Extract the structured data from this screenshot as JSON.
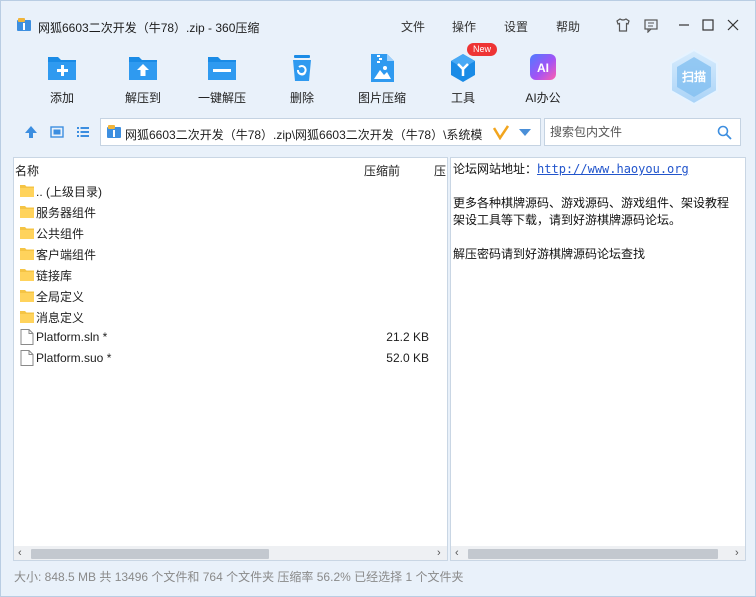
{
  "window": {
    "title": "网狐6603二次开发（牛78）.zip - 360压缩",
    "menu": [
      "文件",
      "操作",
      "设置",
      "帮助"
    ]
  },
  "toolbar": {
    "items": [
      {
        "label": "添加",
        "icon": "add-icon"
      },
      {
        "label": "解压到",
        "icon": "extract-to-icon"
      },
      {
        "label": "一键解压",
        "icon": "one-click-extract-icon"
      },
      {
        "label": "删除",
        "icon": "delete-icon"
      },
      {
        "label": "图片压缩",
        "icon": "image-compress-icon"
      },
      {
        "label": "工具",
        "icon": "tools-icon"
      },
      {
        "label": "AI办公",
        "icon": "ai-office-icon"
      }
    ],
    "new_badge": "New",
    "scan_label": "扫描"
  },
  "address": {
    "path": "网狐6603二次开发（牛78）.zip\\网狐6603二次开发（牛78）\\系统模"
  },
  "search": {
    "placeholder": "搜索包内文件"
  },
  "file_list": {
    "columns": [
      "名称",
      "压缩前",
      "压"
    ],
    "rows": [
      {
        "name": ".. (上级目录)",
        "size": "",
        "type": "folder"
      },
      {
        "name": "服务器组件",
        "size": "",
        "type": "folder"
      },
      {
        "name": "公共组件",
        "size": "",
        "type": "folder"
      },
      {
        "name": "客户端组件",
        "size": "",
        "type": "folder"
      },
      {
        "name": "链接库",
        "size": "",
        "type": "folder"
      },
      {
        "name": "全局定义",
        "size": "",
        "type": "folder"
      },
      {
        "name": "消息定义",
        "size": "",
        "type": "folder"
      },
      {
        "name": "Platform.sln *",
        "size": "21.2 KB",
        "type": "file"
      },
      {
        "name": "Platform.suo *",
        "size": "52.0 KB",
        "type": "file"
      }
    ]
  },
  "comment": {
    "line1_prefix": "论坛网站地址：",
    "line1_link": "http://www.haoyou.org",
    "line2": "更多各种棋牌源码、游戏源码、游戏组件、架设教程",
    "line3": "架设工具等下载，请到好游棋牌源码论坛。",
    "line4": "解压密码请到好游棋牌源码论坛查找"
  },
  "status": "大小: 848.5 MB 共 13496 个文件和 764 个文件夹 压缩率 56.2% 已经选择 1 个文件夹",
  "colors": {
    "window_bg": "#e9f1fa",
    "accent_blue": "#1a8be6",
    "link": "#2255cc",
    "badge_red": "#ee3434"
  }
}
